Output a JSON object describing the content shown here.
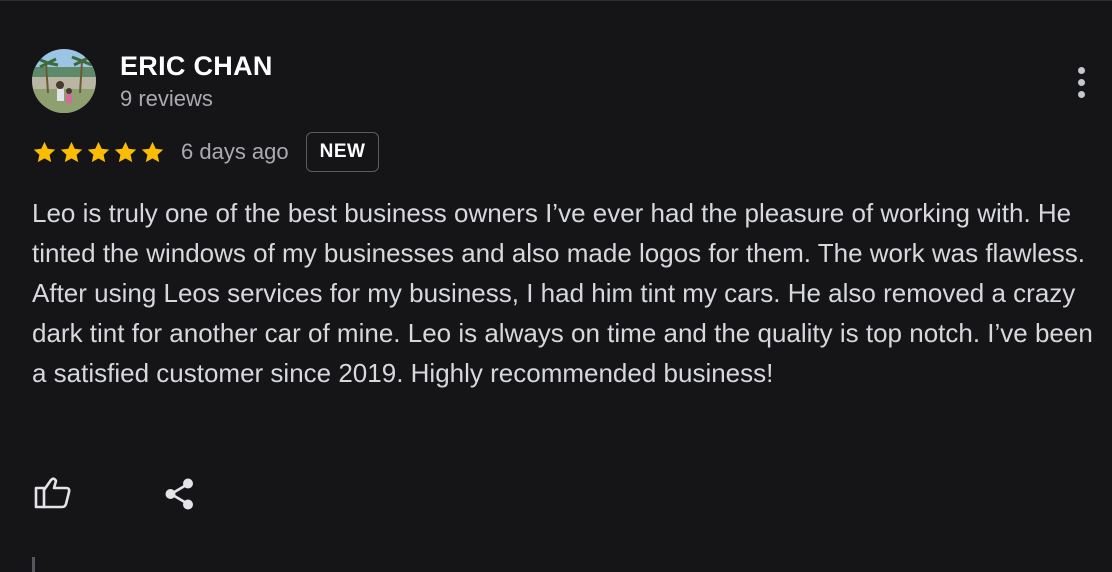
{
  "review": {
    "author": {
      "name": "ERIC CHAN",
      "meta": "9 reviews"
    },
    "rating": 5,
    "date": "6 days ago",
    "badge": "NEW",
    "text": "Leo is truly one of the best business owners I’ve ever had the pleasure of working with. He tinted the windows of my businesses and also made logos for them. The work was flawless. After using Leos services for my business, I had him tint my cars. He also removed a crazy dark tint for another car of mine. Leo is always on time and the quality is top notch. I’ve been a satisfied customer since 2019. Highly recommended business!"
  },
  "colors": {
    "background": "#151518",
    "star": "#fbbc04",
    "text": "#d6d8dc",
    "secondary_text": "#a9abb0"
  },
  "icons": {
    "more": "more-vertical-icon",
    "like": "thumbs-up-icon",
    "share": "share-icon",
    "star": "star-icon"
  }
}
